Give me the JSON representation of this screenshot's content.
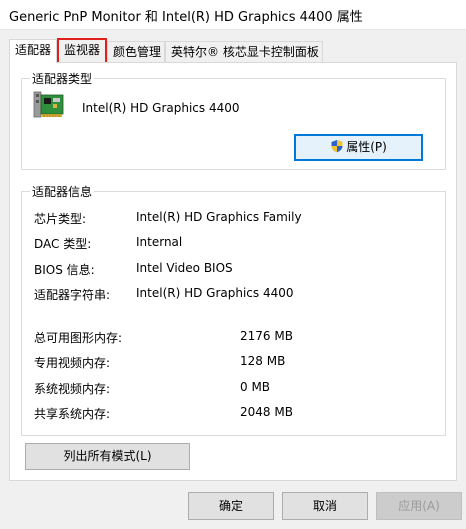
{
  "window": {
    "title": "Generic PnP Monitor 和 Intel(R) HD Graphics 4400 属性"
  },
  "tabs": [
    {
      "label": "适配器",
      "active": true
    },
    {
      "label": "监视器",
      "highlighted": true
    },
    {
      "label": "颜色管理"
    },
    {
      "label": "英特尔® 核芯显卡控制面板"
    }
  ],
  "adapter_type": {
    "group_title": "适配器类型",
    "name": "Intel(R) HD Graphics 4400",
    "properties_button": "属性(P)",
    "icon": "graphics-card-icon",
    "shield_icon": "uac-shield-icon"
  },
  "adapter_info": {
    "group_title": "适配器信息",
    "rows": [
      {
        "label": "芯片类型:",
        "value": "Intel(R) HD Graphics Family"
      },
      {
        "label": "DAC 类型:",
        "value": "Internal"
      },
      {
        "label": "BIOS 信息:",
        "value": "Intel Video BIOS"
      },
      {
        "label": "适配器字符串:",
        "value": "Intel(R) HD Graphics 4400"
      }
    ],
    "memory": [
      {
        "label": "总可用图形内存:",
        "value": "2176 MB"
      },
      {
        "label": "专用视频内存:",
        "value": "128 MB"
      },
      {
        "label": "系统视频内存:",
        "value": "0 MB"
      },
      {
        "label": "共享系统内存:",
        "value": "2048 MB"
      }
    ]
  },
  "list_modes_button": "列出所有模式(L)",
  "footer": {
    "ok": "确定",
    "cancel": "取消",
    "apply": "应用(A)"
  },
  "colors": {
    "highlight_border": "#e0201b",
    "focus_border": "#0078d7"
  }
}
